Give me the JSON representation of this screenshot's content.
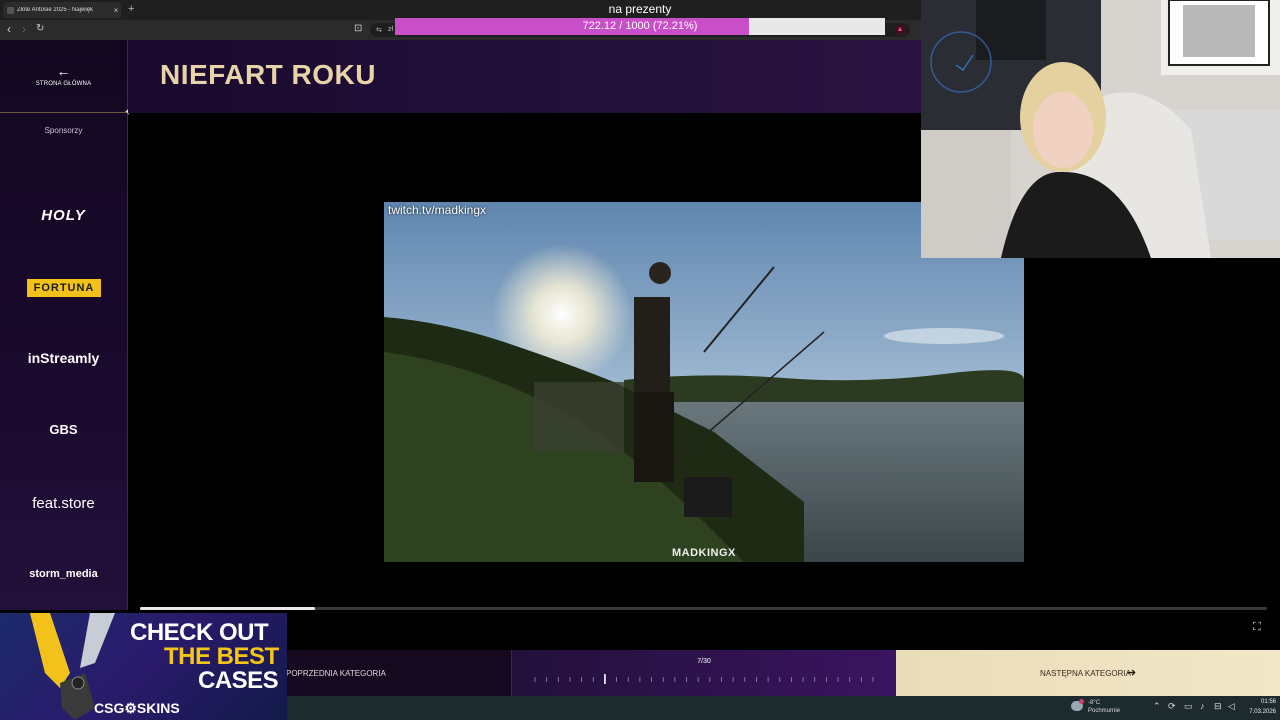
{
  "browser": {
    "tab_title": "Złote Antosie 2025 - Najwięk",
    "tab_close": "×",
    "new_tab": "+",
    "back": "‹",
    "forward": "›",
    "reload": "↻",
    "bookmark": "⊡",
    "site_icon": "⇆",
    "url": "zł"
  },
  "donation": {
    "label": "na prezenty",
    "progress_text": "722.12 / 1000 (72.21%)",
    "current": 722.12,
    "goal": 1000,
    "percent": 72.21
  },
  "sidebar": {
    "home_arrow": "←",
    "home_label": "STRONA GŁÓWNA",
    "sponsors_label": "Sponsorzy",
    "sponsors": [
      "HOLY",
      "FORTUNA",
      "inStreamly",
      "GBS",
      "feat.store",
      "storm_media"
    ],
    "divider_star": "✦"
  },
  "header": {
    "title": "NIEFART ROKU"
  },
  "video": {
    "watermark": "twitch.tv/madkingx",
    "logo": "MADKINGX",
    "progress_fraction": 0.155,
    "fullscreen_glyph": "⛶"
  },
  "navigation": {
    "prev_label": "POPRZEDNIA KATEGORIA",
    "counter": "7/30",
    "current_index": 7,
    "total": 30,
    "next_label": "NASTĘPNA KATEGORIA",
    "next_arrow": "➜"
  },
  "ad": {
    "line1": "CHECK OUT",
    "line2": "THE BEST",
    "line3": "CASES",
    "brand": "CSG⚙SKINS"
  },
  "taskbar": {
    "temperature": "-8°C",
    "condition": "Pochmurnie",
    "time": "01:56",
    "date": "7.03.2026",
    "tray_icons": [
      "chevron-up",
      "sync",
      "network",
      "microphone",
      "volume"
    ]
  },
  "colors": {
    "accent_gold": "#e8d4a8",
    "donation_fill": "#c84fc8",
    "fortuna_yellow": "#f2c21b",
    "ad_yellow": "#f5c518"
  }
}
